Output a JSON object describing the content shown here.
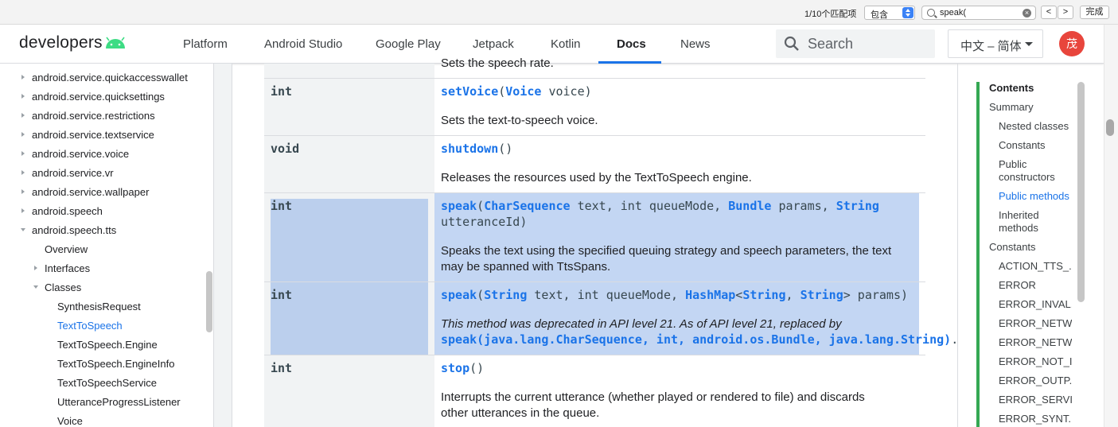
{
  "findbar": {
    "count": "1/10个匹配项",
    "mode": "包含",
    "query": "speak(",
    "prev": "<",
    "next": ">",
    "done": "完成"
  },
  "header": {
    "logo": "developers",
    "nav": [
      "Platform",
      "Android Studio",
      "Google Play",
      "Jetpack",
      "Kotlin",
      "Docs",
      "News"
    ],
    "active_nav": "Docs",
    "search_placeholder": "Search",
    "language": "中文 – 简体",
    "avatar_initial": "茂",
    "brand_color": "#3ddc84",
    "accent": "#1a73e8"
  },
  "leftnav": {
    "items": [
      "android.service.quickaccesswallet",
      "android.service.quicksettings",
      "android.service.restrictions",
      "android.service.textservice",
      "android.service.voice",
      "android.service.vr",
      "android.service.wallpaper",
      "android.speech",
      "android.speech.tts",
      "Overview",
      "Interfaces",
      "Classes",
      "SynthesisRequest",
      "TextToSpeech",
      "TextToSpeech.Engine",
      "TextToSpeech.EngineInfo",
      "TextToSpeechService",
      "UtteranceProgressListener",
      "Voice"
    ],
    "selected": "TextToSpeech"
  },
  "methods": {
    "row0_desc": "Sets the speech rate.",
    "row1": {
      "type": "int",
      "name": "setVoice",
      "p_open": "(",
      "p_type": "Voice",
      "p_rest": " voice)",
      "desc": "Sets the text-to-speech voice."
    },
    "row2": {
      "type": "void",
      "name": "shutdown",
      "params": "()",
      "desc": "Releases the resources used by the TextToSpeech engine."
    },
    "row3": {
      "type": "int",
      "name": "speak",
      "t1": "CharSequence",
      "s1": " text, int queueMode, ",
      "t2": "Bundle",
      "s2": " params, ",
      "t3": "String",
      "line2": "utteranceId)",
      "desc": "Speaks the text using the specified queuing strategy and speech parameters, the text may be spanned with TtsSpans."
    },
    "row4": {
      "type": "int",
      "name": "speak",
      "t1": "String",
      "s1": " text, int queueMode, ",
      "t2": "HashMap",
      "s2": "<",
      "t3": "String",
      "s3": ", ",
      "t4": "String",
      "s4": "> params)",
      "dep_text": "This method was deprecated in API level 21. As of API level 21, replaced by",
      "dep_link": "speak(java.lang.CharSequence, int, android.os.Bundle, java.lang.String)",
      "dep_end": "."
    },
    "row5": {
      "type": "int",
      "name": "stop",
      "params": "()",
      "desc": "Interrupts the current utterance (whether played or rendered to file) and discards other utterances in the queue."
    }
  },
  "toc": {
    "items": [
      "Contents",
      "Summary",
      "Nested classes",
      "Constants",
      "Public constructors",
      "Public methods",
      "Inherited methods",
      "Constants",
      "ACTION_TTS_...",
      "ERROR",
      "ERROR_INVAL...",
      "ERROR_NETW...",
      "ERROR_NETW...",
      "ERROR_NOT_I...",
      "ERROR_OUTP...",
      "ERROR_SERVI...",
      "ERROR_SYNT..."
    ],
    "active": "Public methods"
  }
}
